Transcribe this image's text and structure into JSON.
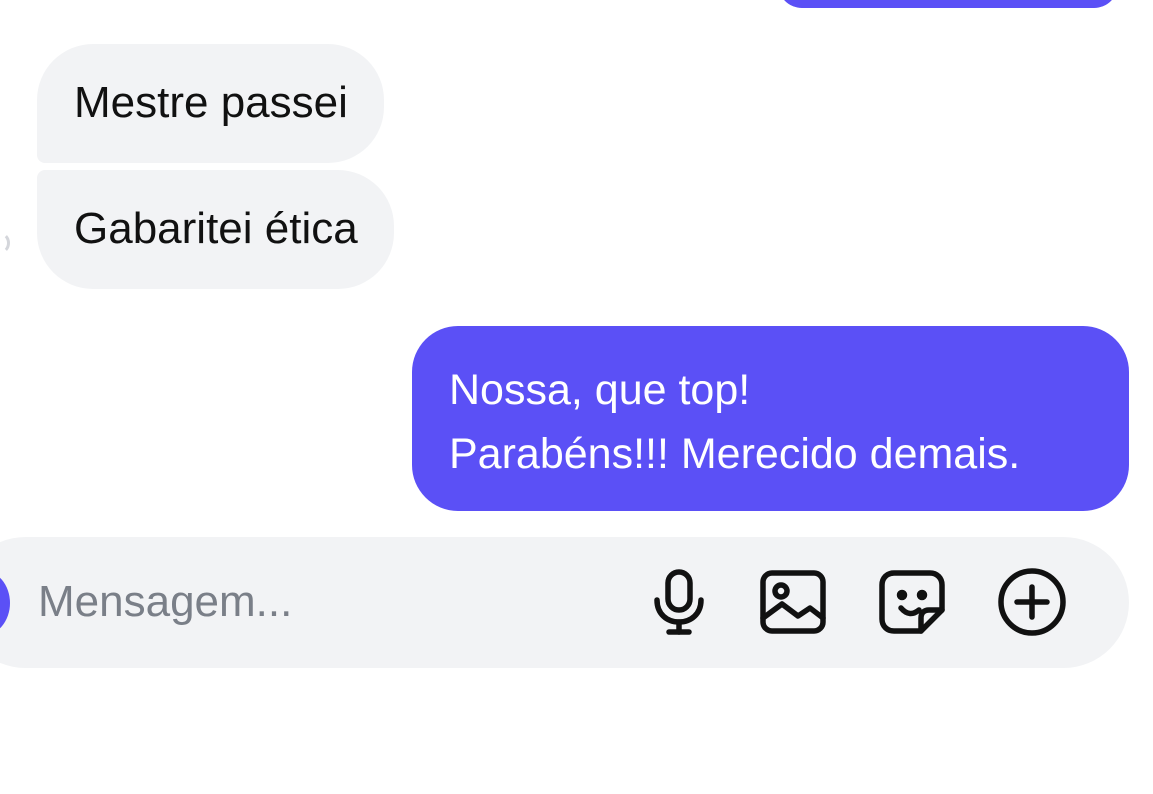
{
  "colors": {
    "accent": "#5b50f6",
    "incoming_bubble": "#f2f3f5",
    "composer_bg": "#f2f3f5",
    "placeholder": "#7a7f88"
  },
  "messages": {
    "incoming": [
      {
        "text": "Mestre passei"
      },
      {
        "text": "Gabaritei ética"
      }
    ],
    "outgoing": {
      "lines": [
        "Nossa, que top!",
        "Parabéns!!! Merecido demais."
      ]
    }
  },
  "composer": {
    "placeholder": "Mensagem...",
    "value": "",
    "icons": [
      "microphone-icon",
      "image-icon",
      "sticker-icon",
      "plus-circle-icon"
    ]
  }
}
